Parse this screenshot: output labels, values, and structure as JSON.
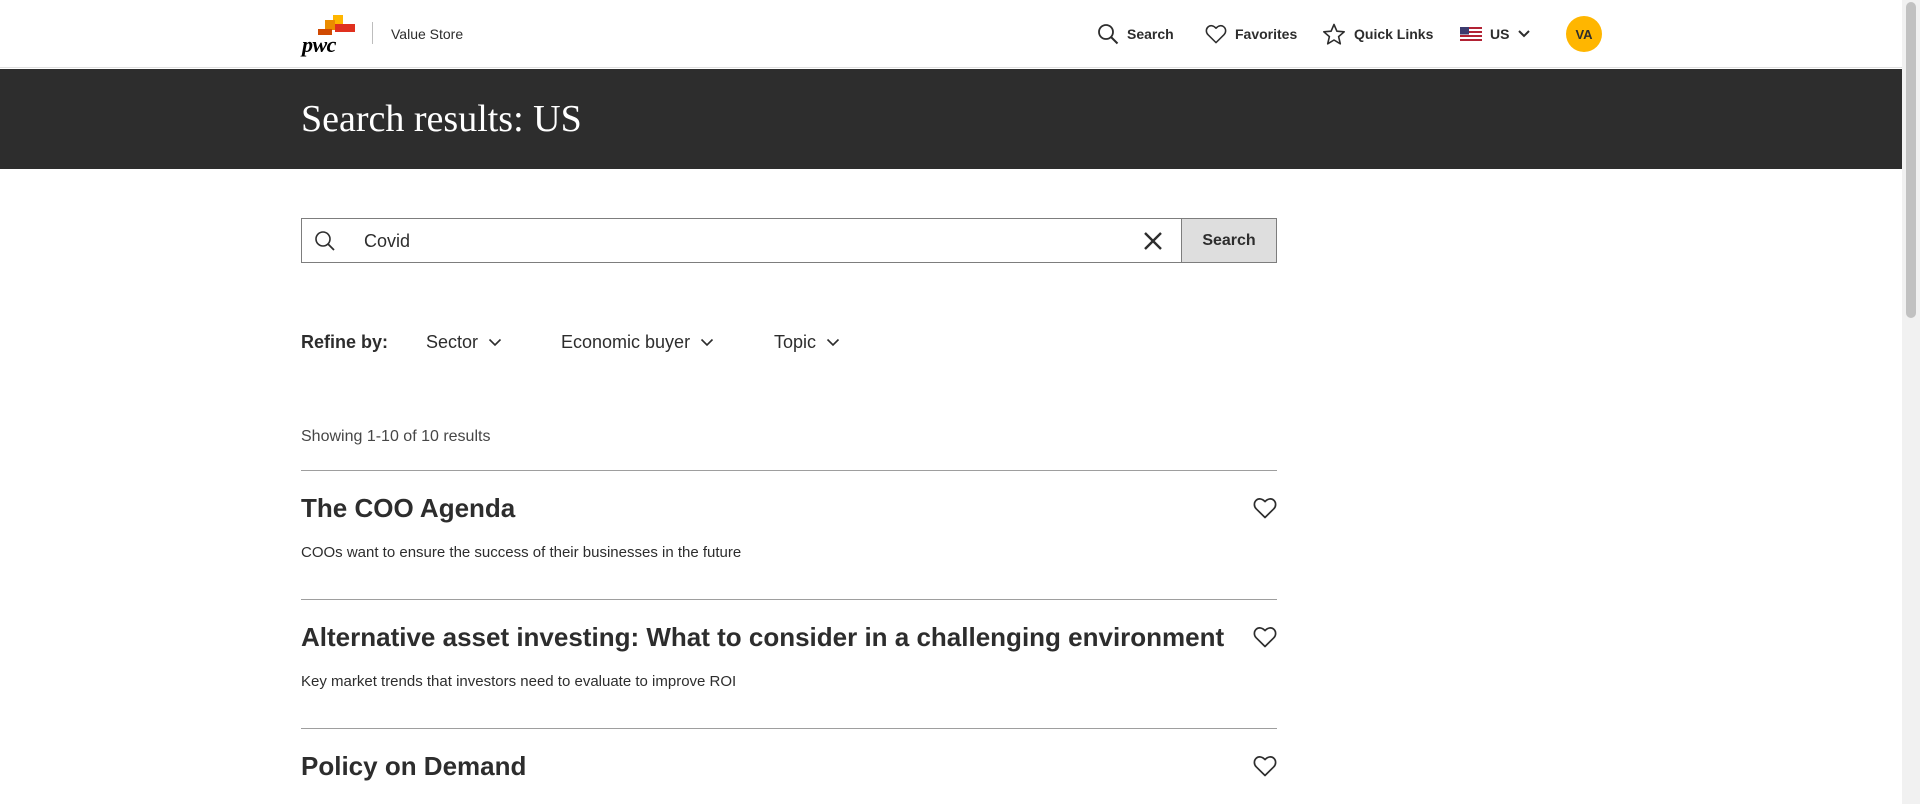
{
  "header": {
    "logo_text": "pwc",
    "store_name": "Value Store",
    "nav": {
      "search": "Search",
      "favorites": "Favorites",
      "quick_links": "Quick Links",
      "region": "US"
    },
    "avatar_initials": "VA"
  },
  "banner": {
    "title": "Search results: US"
  },
  "search": {
    "value": "Covid",
    "button_label": "Search"
  },
  "refine": {
    "label": "Refine by:",
    "filters": [
      "Sector",
      "Economic buyer",
      "Topic"
    ]
  },
  "results": {
    "count_text": "Showing 1-10 of 10 results",
    "items": [
      {
        "title": "The COO Agenda",
        "description": "COOs want to ensure the success of their businesses in the future"
      },
      {
        "title": "Alternative asset investing: What to consider in a challenging environment",
        "description": "Key market trends that investors need to evaluate to improve ROI"
      },
      {
        "title": "Policy on Demand",
        "description": ""
      }
    ]
  },
  "colors": {
    "banner_bg": "#2d2d2d",
    "avatar_bg": "#FFB600",
    "brand_orange": "#D04A02",
    "text": "#2d2d2d"
  }
}
